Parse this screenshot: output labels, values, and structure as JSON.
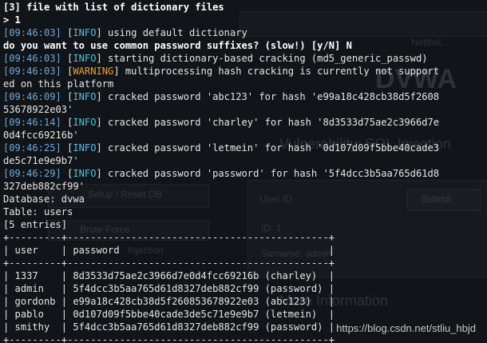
{
  "background_ghost": {
    "submit": "Submit",
    "brute_force": "Brute Force",
    "injection": "Injection",
    "user_id": "User ID:",
    "id_line": "ID: 1",
    "surname_line": "Surname: admin",
    "setup": "Setup / Reset DB",
    "dvwa_logo": "DVWA",
    "net_label": "Nettfoli...",
    "vuln_title": "Vulnerability: SQL Injection",
    "more_info": "More Information"
  },
  "lines": [
    {
      "parts": [
        {
          "t": "[3] file with list of dictionary files",
          "c": "b"
        }
      ]
    },
    {
      "parts": [
        {
          "t": "> 1",
          "c": "b"
        }
      ]
    },
    {
      "parts": [
        {
          "t": "[09:46:03]",
          "c": "ts"
        },
        {
          "t": " [",
          "c": ""
        },
        {
          "t": "INFO",
          "c": "info"
        },
        {
          "t": "] using default dictionary",
          "c": ""
        }
      ]
    },
    {
      "parts": [
        {
          "t": "do you want to use common password suffixes? (slow!) [y/N] N",
          "c": "b"
        }
      ]
    },
    {
      "parts": [
        {
          "t": "[09:46:03]",
          "c": "ts"
        },
        {
          "t": " [",
          "c": ""
        },
        {
          "t": "INFO",
          "c": "info"
        },
        {
          "t": "] starting dictionary-based cracking (md5_generic_passwd)",
          "c": ""
        }
      ]
    },
    {
      "parts": [
        {
          "t": "[09:46:03]",
          "c": "ts"
        },
        {
          "t": " [",
          "c": ""
        },
        {
          "t": "WARNING",
          "c": "warn"
        },
        {
          "t": "] multiprocessing hash cracking is currently not support",
          "c": ""
        }
      ]
    },
    {
      "parts": [
        {
          "t": "ed on this platform",
          "c": ""
        }
      ]
    },
    {
      "parts": [
        {
          "t": "[09:46:09]",
          "c": "ts"
        },
        {
          "t": " [",
          "c": ""
        },
        {
          "t": "INFO",
          "c": "info"
        },
        {
          "t": "] cracked password 'abc123' for hash 'e99a18c428cb38d5f2608",
          "c": ""
        }
      ]
    },
    {
      "parts": [
        {
          "t": "53678922e03'",
          "c": ""
        }
      ]
    },
    {
      "parts": [
        {
          "t": "[09:46:14]",
          "c": "ts"
        },
        {
          "t": " [",
          "c": ""
        },
        {
          "t": "INFO",
          "c": "info"
        },
        {
          "t": "] cracked password 'charley' for hash '8d3533d75ae2c3966d7e",
          "c": ""
        }
      ]
    },
    {
      "parts": [
        {
          "t": "0d4fcc69216b'",
          "c": ""
        }
      ]
    },
    {
      "parts": [
        {
          "t": "[09:46:25]",
          "c": "ts"
        },
        {
          "t": " [",
          "c": ""
        },
        {
          "t": "INFO",
          "c": "info"
        },
        {
          "t": "] cracked password 'letmein' for hash '0d107d09f5bbe40cade3",
          "c": ""
        }
      ]
    },
    {
      "parts": [
        {
          "t": "de5c71e9e9b7'",
          "c": ""
        }
      ]
    },
    {
      "parts": [
        {
          "t": "[09:46:29]",
          "c": "ts"
        },
        {
          "t": " [",
          "c": ""
        },
        {
          "t": "INFO",
          "c": "info"
        },
        {
          "t": "] cracked password 'password' for hash '5f4dcc3b5aa765d61d8",
          "c": ""
        }
      ]
    },
    {
      "parts": [
        {
          "t": "327deb882cf99'",
          "c": ""
        }
      ]
    },
    {
      "parts": [
        {
          "t": "Database: dvwa",
          "c": ""
        }
      ]
    },
    {
      "parts": [
        {
          "t": "Table: users",
          "c": ""
        }
      ]
    },
    {
      "parts": [
        {
          "t": "[5 entries]",
          "c": ""
        }
      ]
    },
    {
      "parts": [
        {
          "t": "+---------+---------------------------------------------+",
          "c": ""
        }
      ]
    },
    {
      "parts": [
        {
          "t": "| user    | password                                    |",
          "c": ""
        }
      ]
    },
    {
      "parts": [
        {
          "t": "+---------+---------------------------------------------+",
          "c": ""
        }
      ]
    },
    {
      "parts": [
        {
          "t": "| 1337    | 8d3533d75ae2c3966d7e0d4fcc69216b (charley)  |",
          "c": ""
        }
      ]
    },
    {
      "parts": [
        {
          "t": "| admin   | 5f4dcc3b5aa765d61d8327deb882cf99 (password) |",
          "c": ""
        }
      ]
    },
    {
      "parts": [
        {
          "t": "| gordonb | e99a18c428cb38d5f260853678922e03 (abc123)   |",
          "c": ""
        }
      ]
    },
    {
      "parts": [
        {
          "t": "| pablo   | 0d107d09f5bbe40cade3de5c71e9e9b7 (letmein)  |",
          "c": ""
        }
      ]
    },
    {
      "parts": [
        {
          "t": "| smithy  | 5f4dcc3b5aa765d61d8327deb882cf99 (password) |",
          "c": ""
        }
      ]
    },
    {
      "parts": [
        {
          "t": "+---------+---------------------------------------------+",
          "c": ""
        }
      ]
    }
  ],
  "watermark": "https://blog.csdn.net/stliu_hbjd",
  "colors": {
    "background": "#111418",
    "timestamp": "#6fa8dc",
    "info": "#4fc3e8",
    "warning": "#f0a030",
    "text": "#e6e6e6"
  }
}
